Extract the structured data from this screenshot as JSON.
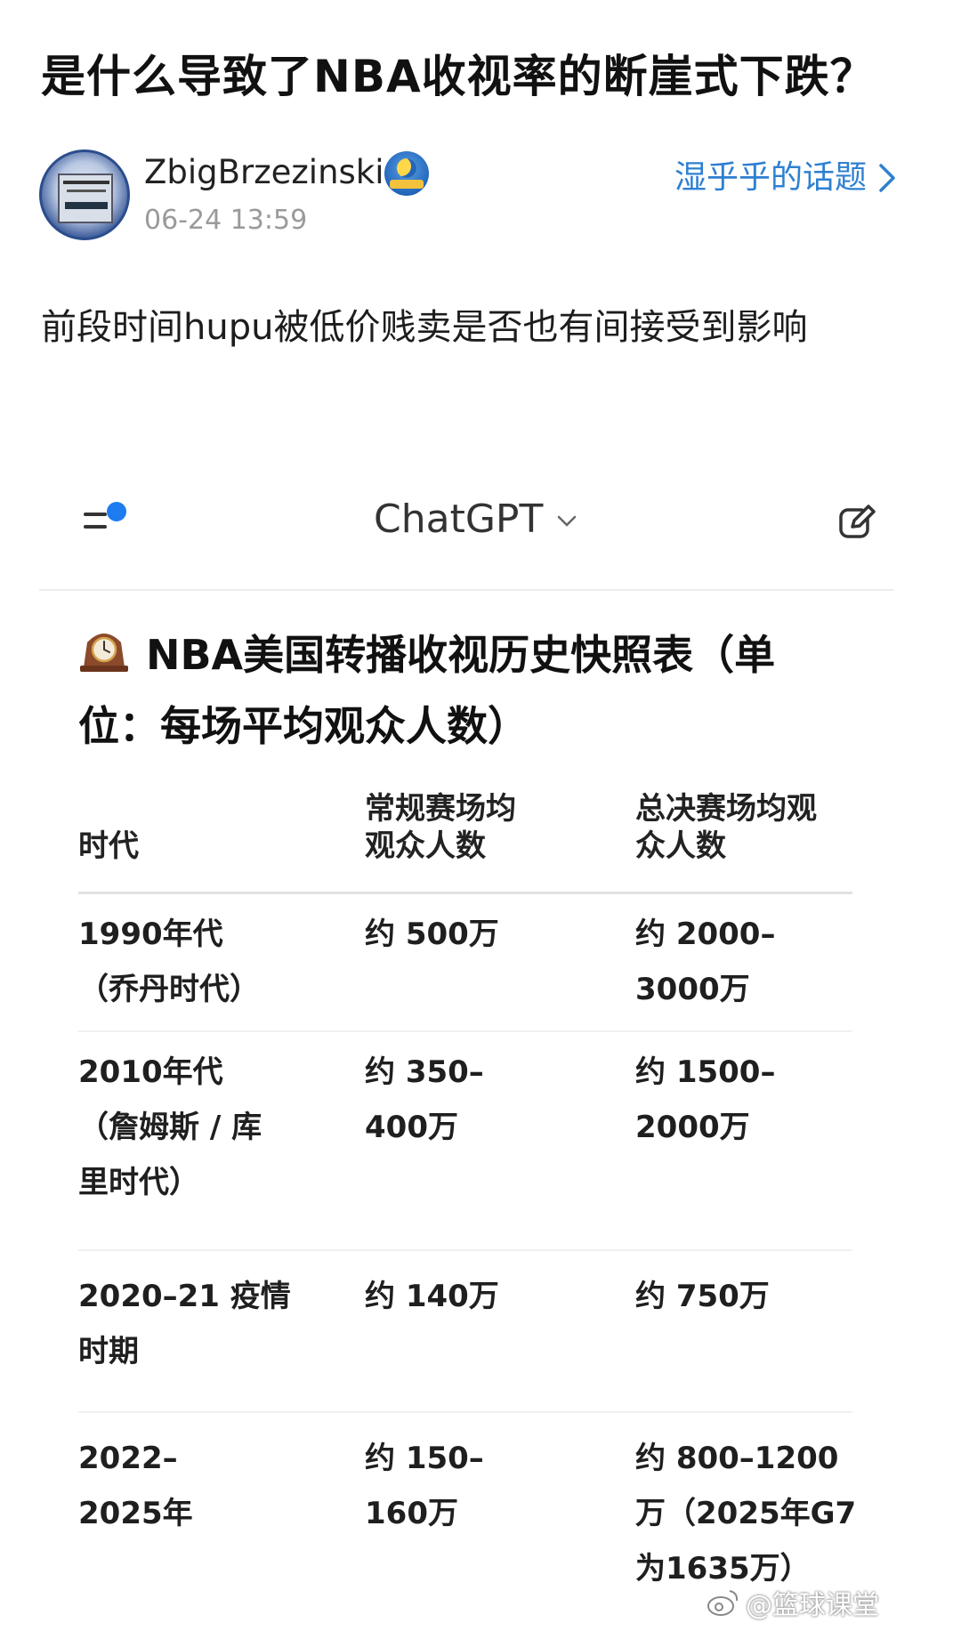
{
  "question": {
    "title": "是什么导致了NBA收视率的断崖式下跌？"
  },
  "author": {
    "name": "ZbigBrzezinski",
    "timestamp": "06-24 13:59"
  },
  "topic_link": "湿乎乎的话题",
  "post": {
    "text": "前段时间hupu被低价贱卖是否也有间接受到影响"
  },
  "chatgpt": {
    "app_title": "ChatGPT",
    "table_title": "NBA美国转播收视历史快照表（单位：每场平均观众人数）",
    "headers": [
      "时代",
      "常规赛场均观众人数",
      "总决赛场均观众人数"
    ],
    "rows": [
      {
        "era": "1990年代（乔丹时代）",
        "regular": "约 500万",
        "finals": "约 2000–3000万"
      },
      {
        "era": "2010年代（詹姆斯 / 库里时代）",
        "regular": "约 350–400万",
        "finals": "约 1500–2000万"
      },
      {
        "era": "2020–21 疫情时期",
        "regular": "约 140万",
        "finals": "约 750万"
      },
      {
        "era": "2022–2025年",
        "regular": "约 150–160万",
        "finals": "约 800–1200万（2025年G7为1635万）"
      }
    ]
  },
  "watermark": "@篮球课堂",
  "colors": {
    "link": "#2f80d1",
    "accent_dot": "#1e7cf0",
    "timestamp": "#9a9a9a"
  }
}
